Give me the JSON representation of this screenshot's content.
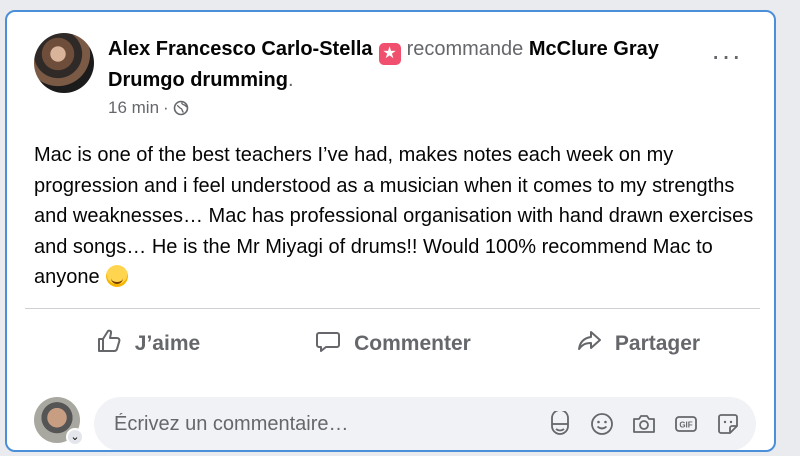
{
  "post": {
    "author": "Alex Francesco Carlo-Stella",
    "action": "recommande",
    "page": "McClure Gray Drumgo drumming",
    "page_end": ".",
    "time": "16 min",
    "time_separator": "·",
    "text": "Mac is one of the best teachers I’ve had, makes notes each week on my progression and i feel understood as a musician when it comes to my strengths and weaknesses… Mac has professional organisation with hand drawn exercises and songs… He is the Mr Miyagi of drums!! Would 100% recommend Mac to anyone",
    "recommend_icon": "star-tag-icon",
    "emoji": "smiling-face-emoji"
  },
  "actions": {
    "like": "J’aime",
    "comment": "Commenter",
    "share": "Partager"
  },
  "comment": {
    "placeholder": "Écrivez un commentaire…",
    "tools": [
      "avatar-sticker-icon",
      "emoji-icon",
      "camera-icon",
      "gif-icon",
      "sticker-icon"
    ]
  },
  "colors": {
    "accent_border": "#4b8fd8",
    "recommend_badge": "#f0506e",
    "muted_text": "#65676b"
  }
}
